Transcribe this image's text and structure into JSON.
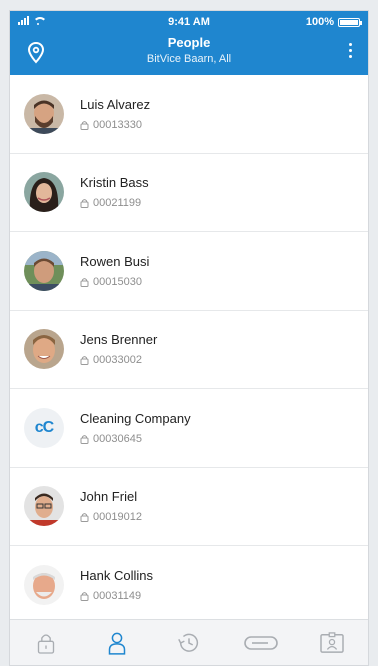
{
  "status_bar": {
    "time": "9:41 AM",
    "battery": "100%"
  },
  "header": {
    "title": "People",
    "subtitle": "BitVice Baarn, All"
  },
  "people": [
    {
      "name": "Luis Alvarez",
      "code": "00013330",
      "avatar": "photo-man-beard"
    },
    {
      "name": "Kristin Bass",
      "code": "00021199",
      "avatar": "photo-woman-dark-hair"
    },
    {
      "name": "Rowen Busi",
      "code": "00015030",
      "avatar": "photo-man-outdoor"
    },
    {
      "name": "Jens Brenner",
      "code": "00033002",
      "avatar": "photo-man-smiling"
    },
    {
      "name": "Cleaning Company",
      "code": "00030645",
      "avatar_initials": "cC"
    },
    {
      "name": "John Friel",
      "code": "00019012",
      "avatar": "photo-man-glasses"
    },
    {
      "name": "Hank Collins",
      "code": "00031149",
      "avatar": "photo-older-man"
    }
  ],
  "tabs": [
    {
      "icon": "lock-icon",
      "active": false
    },
    {
      "icon": "person-icon",
      "active": true
    },
    {
      "icon": "history-icon",
      "active": false
    },
    {
      "icon": "key-card-icon",
      "active": false
    },
    {
      "icon": "badge-icon",
      "active": false
    }
  ],
  "colors": {
    "accent": "#1f86cf",
    "inactive_tab": "#a9adb2",
    "divider": "#e6e8ea"
  }
}
